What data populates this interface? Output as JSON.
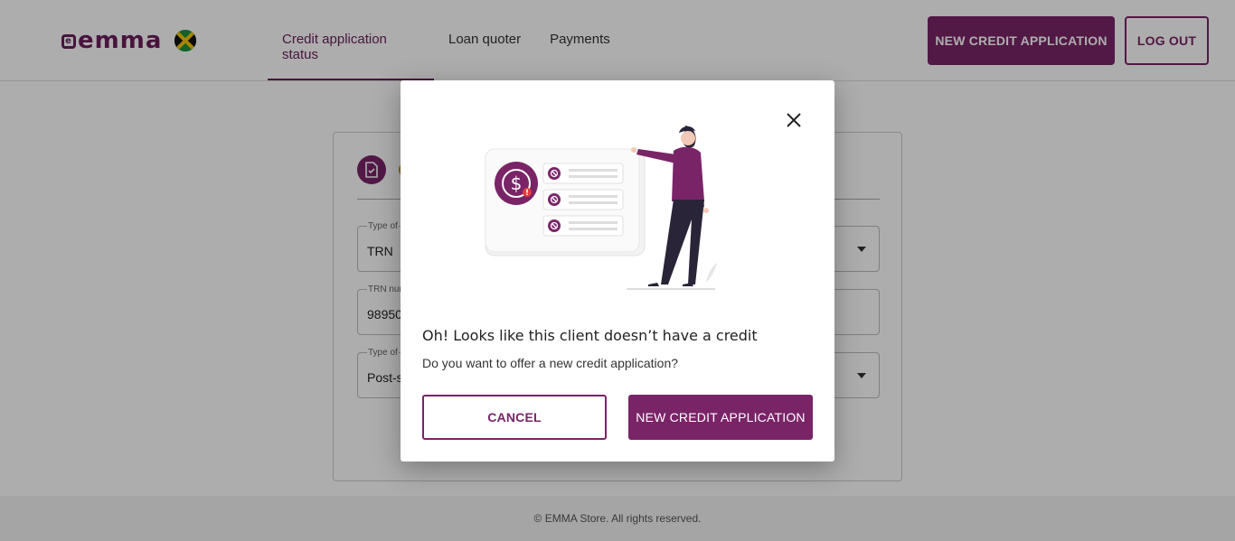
{
  "header": {
    "logo_text": "emma",
    "nav": [
      {
        "label": "Credit application status",
        "active": true
      },
      {
        "label": "Loan quoter",
        "active": false
      },
      {
        "label": "Payments",
        "active": false
      }
    ],
    "new_credit_button": "NEW CREDIT APPLICATION",
    "logout_button": "LOG OUT"
  },
  "form": {
    "fields": [
      {
        "label": "Type of",
        "value": "TRN",
        "has_dropdown": true
      },
      {
        "label": "TRN num",
        "value": "98950",
        "has_dropdown": false
      },
      {
        "label": "Type of",
        "value": "Post-s",
        "has_dropdown": true
      }
    ]
  },
  "footer": {
    "text": "© EMMA Store. All rights reserved."
  },
  "modal": {
    "title": "Oh! Looks like this client doesn’t have a credit",
    "subtitle": "Do you want to offer a new credit application?",
    "cancel_button": "CANCEL",
    "confirm_button": "NEW CREDIT APPLICATION"
  },
  "colors": {
    "brand": "#7a2468",
    "overlay": "rgba(0,0,0,0.32)"
  },
  "icons": [
    "close-icon",
    "dollar-alert-icon",
    "block-icon",
    "document-check-icon",
    "chevron-down-icon"
  ]
}
